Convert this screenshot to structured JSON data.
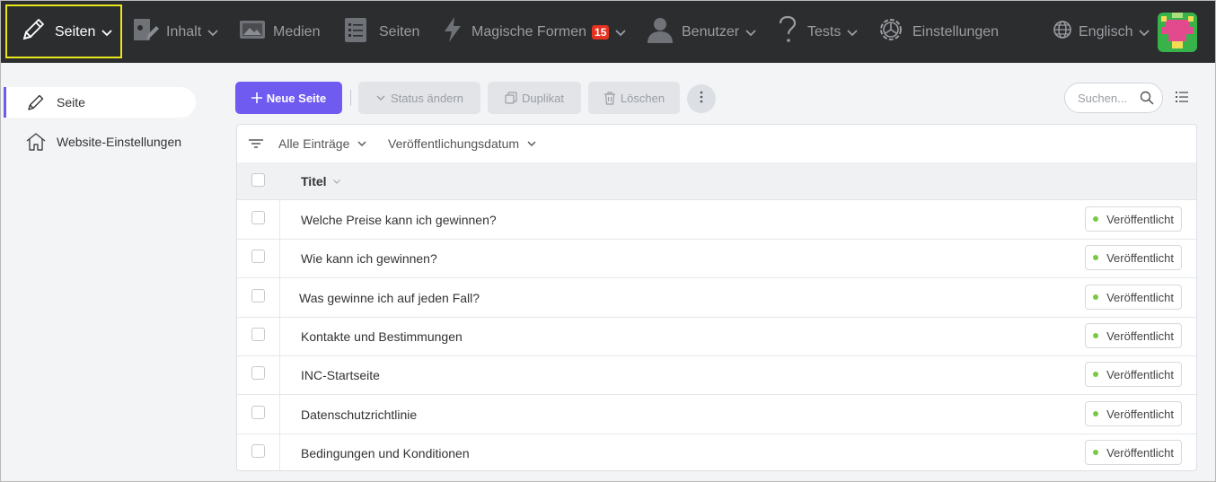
{
  "nav": {
    "items": [
      {
        "label": "Seiten",
        "icon": "pencil-icon"
      },
      {
        "label": "Inhalt",
        "icon": "content-icon"
      },
      {
        "label": "Medien",
        "icon": "media-icon"
      },
      {
        "label": "Seiten",
        "icon": "pages-icon"
      },
      {
        "label": "Magische Formen",
        "icon": "lightning-icon",
        "badge": "15"
      },
      {
        "label": "Benutzer",
        "icon": "user-icon"
      },
      {
        "label": "Tests",
        "icon": "question-icon"
      },
      {
        "label": "Einstellungen",
        "icon": "gear-icon"
      }
    ],
    "language": "Englisch",
    "accent": "#e9e61c"
  },
  "sidebar": {
    "items": [
      {
        "label": "Seite",
        "icon": "pencil-icon"
      },
      {
        "label": "Website-Einstellungen",
        "icon": "home-icon"
      }
    ]
  },
  "toolbar": {
    "new_page": "Neue Seite",
    "change_status": "Status ändern",
    "duplicate": "Duplikat",
    "delete": "Löschen",
    "search_placeholder": "Suchen..."
  },
  "filters": {
    "all_entries": "Alle Einträge",
    "publish_date": "Veröffentlichungsdatum"
  },
  "table": {
    "header_title": "Titel",
    "rows": [
      {
        "title": "Welche Preise kann ich gewinnen?",
        "status": "Veröffentlicht"
      },
      {
        "title": "Wie kann ich gewinnen?",
        "status": "Veröffentlicht"
      },
      {
        "title": "Was gewinne ich auf jeden Fall?",
        "status": "Veröffentlicht"
      },
      {
        "title": "Kontakte und Bestimmungen",
        "status": "Veröffentlicht"
      },
      {
        "title": "INC-Startseite",
        "status": "Veröffentlicht"
      },
      {
        "title": "Datenschutzrichtlinie",
        "status": "Veröffentlicht"
      },
      {
        "title": "Bedingungen und Konditionen",
        "status": "Veröffentlicht"
      }
    ]
  },
  "colors": {
    "primary": "#6f5bf0",
    "topbar": "#2c2d2f",
    "published_dot": "#7ac943"
  }
}
